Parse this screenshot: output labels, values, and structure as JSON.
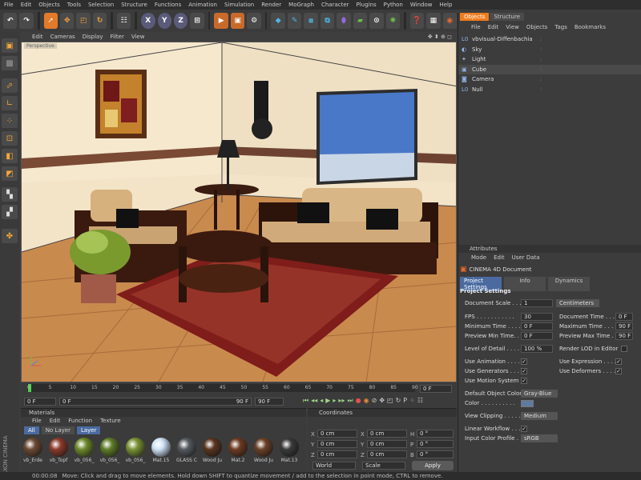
{
  "menubar": [
    "File",
    "Edit",
    "Objects",
    "Tools",
    "Selection",
    "Structure",
    "Functions",
    "Animation",
    "Simulation",
    "Render",
    "MoGraph",
    "Character",
    "Plugins",
    "Python",
    "Window",
    "Help"
  ],
  "viewport": {
    "menu": [
      "Edit",
      "Cameras",
      "Display",
      "Filter",
      "View"
    ],
    "label": "Perspective",
    "nav_icons": "✥ ⬍ ⊕ ◻"
  },
  "timeline": {
    "ticks": [
      "0",
      "5",
      "10",
      "15",
      "20",
      "25",
      "30",
      "35",
      "40",
      "45",
      "50",
      "55",
      "60",
      "65",
      "70",
      "75",
      "80",
      "85",
      "90"
    ],
    "frame_right": "0 F",
    "field_a": "0 F",
    "field_b": "0 F",
    "field_c": "90 F",
    "field_d": "90 F"
  },
  "objects": {
    "tabs": [
      "Objects",
      "Structure"
    ],
    "menu": [
      "File",
      "Edit",
      "View",
      "Objects",
      "Tags",
      "Bookmarks"
    ],
    "items": [
      {
        "name": "vbvisual-Diffenbachia",
        "icon": "L0"
      },
      {
        "name": "Sky",
        "icon": "◐"
      },
      {
        "name": "Light",
        "icon": "✦"
      },
      {
        "name": "Cube",
        "icon": "▣"
      },
      {
        "name": "Camera",
        "icon": "◙"
      },
      {
        "name": "Null",
        "icon": "L0"
      }
    ]
  },
  "attributes": {
    "title": "Attributes",
    "menu": [
      "Mode",
      "Edit",
      "User Data"
    ],
    "doc": "CINEMA 4D Document",
    "tabs": [
      "Project Settings",
      "Info",
      "Dynamics"
    ],
    "section": "Project Settings",
    "doc_scale_label": "Document Scale . . .",
    "doc_scale": "1",
    "doc_unit": "Centimeters",
    "fps_label": "FPS . . . . . . . . . . .",
    "fps": "30",
    "doc_time_label": "Document Time . . . .",
    "doc_time": "0 F",
    "min_time_label": "Minimum Time . . . .",
    "min_time": "0 F",
    "max_time_label": "Maximum Time . . . .",
    "max_time": "90 F",
    "prev_min_label": "Preview Min Time. . .",
    "prev_min": "0 F",
    "prev_max_label": "Preview Max Time . .",
    "prev_max": "90 F",
    "lod_label": "Level of Detail . . . .",
    "lod": "100 %",
    "render_lod_label": "Render LOD in Editor",
    "use_anim": "Use Animation . . . .",
    "use_expr": "Use Expression . . . .",
    "use_gen": "Use Generators . . . .",
    "use_def": "Use Deformers . . . .",
    "use_motion": "Use Motion System . .",
    "def_color_label": "Default Object Color",
    "def_color": "Gray-Blue",
    "color_label": "Color . . . . . . . . . .",
    "clipping_label": "View Clipping . . . . .",
    "clipping": "Medium",
    "linear_label": "Linear Workflow . . . .",
    "profile_label": "Input Color Profile . .",
    "profile": "sRGB"
  },
  "materials": {
    "title": "Materials",
    "menu": [
      "File",
      "Edit",
      "Function",
      "Texture"
    ],
    "filters": [
      "All",
      "No Layer",
      "Layer"
    ],
    "items": [
      {
        "name": "vb_Erde",
        "color": "#6b4a33"
      },
      {
        "name": "vb_Topf",
        "color": "#8a3b2a"
      },
      {
        "name": "vb_056_",
        "color": "#6e8a2c"
      },
      {
        "name": "vb_056_",
        "color": "#5f7d28"
      },
      {
        "name": "vb_056_",
        "color": "#7a9334"
      },
      {
        "name": "Mat.15",
        "color": "#cfe3f5"
      },
      {
        "name": "GLASS C",
        "color": "#555a60"
      },
      {
        "name": "Wood Ju",
        "color": "#5a3520"
      },
      {
        "name": "Mat.2",
        "color": "#6e3b22"
      },
      {
        "name": "Wood Ju",
        "color": "#6a4128"
      },
      {
        "name": "Mat.13",
        "color": "#3a3a3a"
      }
    ]
  },
  "coords": {
    "title": "Coordinates",
    "x": "0 cm",
    "y": "0 cm",
    "z": "0 cm",
    "x2": "0 cm",
    "y2": "0 cm",
    "z2": "0 cm",
    "h": "0 °",
    "p": "0 °",
    "b": "0 °",
    "mode1": "World",
    "mode2": "Scale",
    "apply": "Apply"
  },
  "status": {
    "time": "00:00:08",
    "text": "Move: Click and drag to move elements. Hold down SHIFT to quantize movement / add to the selection in point mode, CTRL to remove."
  },
  "brand": {
    "line1": "MAXON",
    "line2": "CINEMA 4D"
  },
  "colors": {
    "accent": "#f07c1e",
    "panel": "#3c3c3c",
    "wall": "#f4e6cc",
    "floor": "#c98a4e"
  }
}
